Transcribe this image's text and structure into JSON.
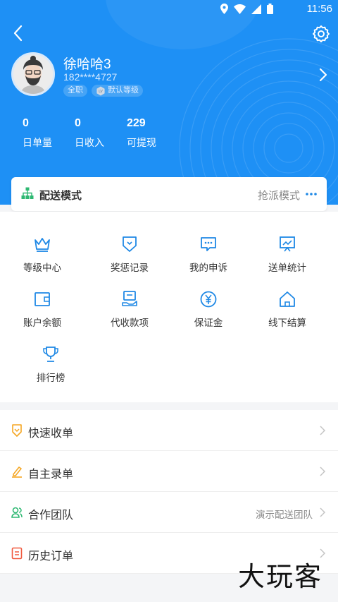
{
  "status": {
    "time": "11:56"
  },
  "profile": {
    "name": "徐哈哈3",
    "phone": "182****4727",
    "tags": [
      "全职",
      "默认等级"
    ]
  },
  "stats": [
    {
      "value": "0",
      "label": "日单量"
    },
    {
      "value": "0",
      "label": "日收入"
    },
    {
      "value": "229",
      "label": "可提现"
    }
  ],
  "delivery_mode": {
    "label": "配送模式",
    "value": "抢派模式"
  },
  "features": [
    {
      "label": "等级中心",
      "icon": "crown-icon"
    },
    {
      "label": "奖惩记录",
      "icon": "shield-icon"
    },
    {
      "label": "我的申诉",
      "icon": "message-icon"
    },
    {
      "label": "送单统计",
      "icon": "chart-icon"
    },
    {
      "label": "账户余额",
      "icon": "wallet-icon"
    },
    {
      "label": "代收款项",
      "icon": "collection-icon"
    },
    {
      "label": "保证金",
      "icon": "yen-icon"
    },
    {
      "label": "线下结算",
      "icon": "house-icon"
    },
    {
      "label": "排行榜",
      "icon": "trophy-icon"
    }
  ],
  "menu": [
    {
      "label": "快速收单",
      "extra": "",
      "icon": "receive-icon",
      "color": "#f5a623"
    },
    {
      "label": "自主录单",
      "extra": "",
      "icon": "pen-icon",
      "color": "#f5a623"
    },
    {
      "label": "合作团队",
      "extra": "演示配送团队",
      "icon": "team-icon",
      "color": "#2eb872"
    },
    {
      "label": "历史订单",
      "extra": "",
      "icon": "history-icon",
      "color": "#f0593e"
    }
  ],
  "watermark": "大玩客",
  "colors": {
    "brand": "#1e90f5",
    "icon_blue": "#1e88e5"
  }
}
